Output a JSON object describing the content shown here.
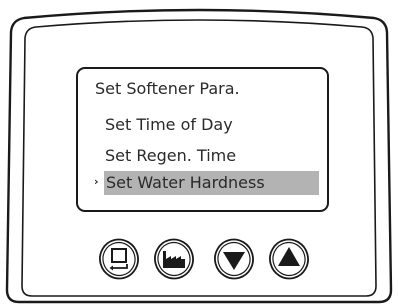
{
  "screen": {
    "title": "Set Softener Para.",
    "items": [
      {
        "label": "Set Time of Day",
        "selected": false
      },
      {
        "label": "Set Regen. Time",
        "selected": false
      },
      {
        "label": "Set Water Hardness",
        "selected": true
      }
    ],
    "pointer_glyph": "›"
  },
  "buttons": [
    {
      "name": "menu-button",
      "icon": "menu-return-icon"
    },
    {
      "name": "regen-button",
      "icon": "factory-icon"
    },
    {
      "name": "down-button",
      "icon": "triangle-down-icon"
    },
    {
      "name": "up-button",
      "icon": "triangle-up-icon"
    }
  ],
  "colors": {
    "bezel": "#1a1a1a",
    "highlight": "#b3b3b3",
    "text": "#2a2a2a",
    "background": "#ffffff"
  }
}
